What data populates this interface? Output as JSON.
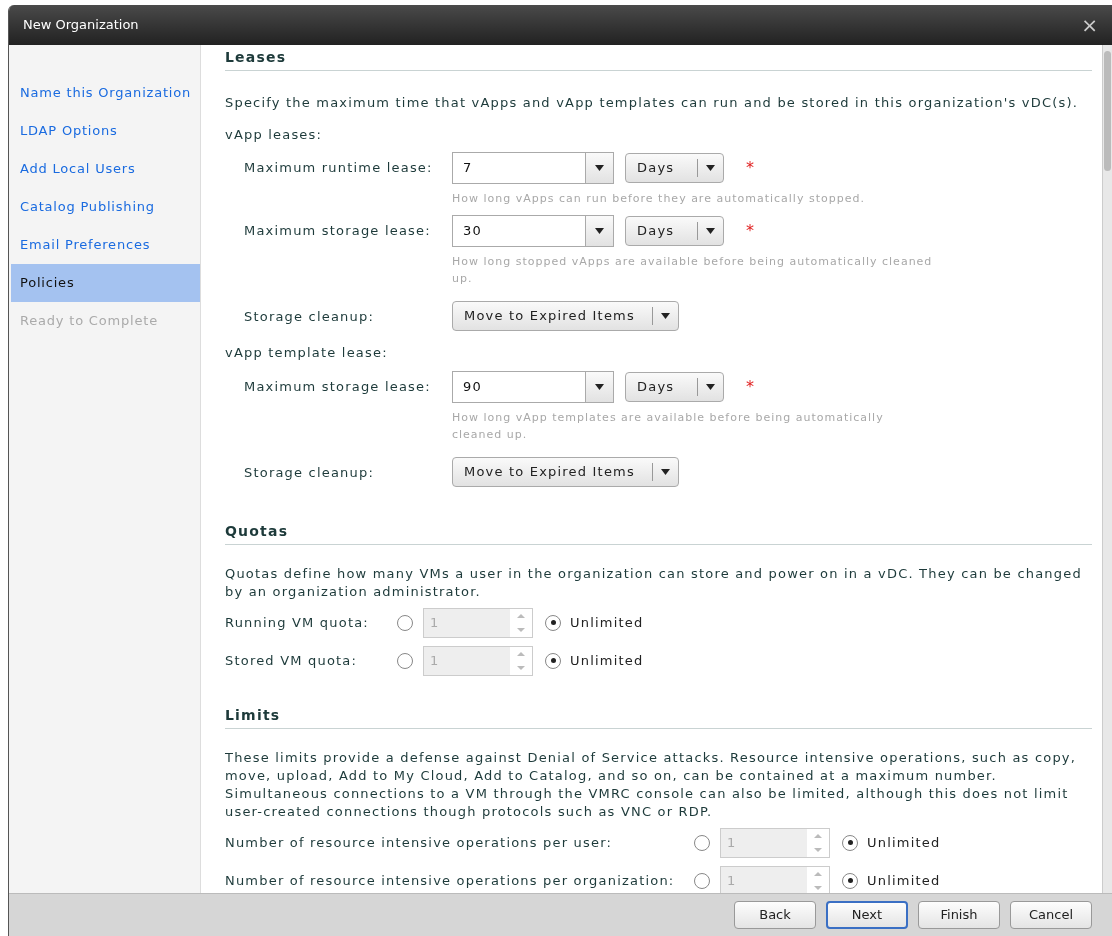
{
  "window": {
    "title": "New Organization",
    "close": "×"
  },
  "sidebar": {
    "items": [
      {
        "label": "Name this Organization",
        "selected": false,
        "disabled": false
      },
      {
        "label": "LDAP Options",
        "selected": false,
        "disabled": false
      },
      {
        "label": "Add Local Users",
        "selected": false,
        "disabled": false
      },
      {
        "label": "Catalog Publishing",
        "selected": false,
        "disabled": false
      },
      {
        "label": "Email Preferences",
        "selected": false,
        "disabled": false
      },
      {
        "label": "Policies",
        "selected": true,
        "disabled": false
      },
      {
        "label": "Ready to Complete",
        "selected": false,
        "disabled": true
      }
    ]
  },
  "leases": {
    "heading": "Leases",
    "description": "Specify the maximum time that vApps and vApp templates can run and be stored in this organization's vDC(s).",
    "groups": [
      {
        "label": "vApp leases:",
        "fields": [
          {
            "kind": "lease",
            "label": "Maximum runtime lease:",
            "value": "7",
            "unit": "Days",
            "required": true,
            "required_mark": "*",
            "hint": "How long vApps can run before they are automatically stopped."
          },
          {
            "kind": "lease",
            "label": "Maximum storage lease:",
            "value": "30",
            "unit": "Days",
            "required": true,
            "required_mark": "*",
            "hint": "How long stopped vApps are available before being automatically cleaned up."
          },
          {
            "kind": "select",
            "label": "Storage cleanup:",
            "value": "Move to Expired Items"
          }
        ]
      },
      {
        "label": "vApp template lease:",
        "fields": [
          {
            "kind": "lease",
            "label": "Maximum storage lease:",
            "value": "90",
            "unit": "Days",
            "required": true,
            "required_mark": "*",
            "hint": "How long vApp templates are available before being automatically cleaned up."
          },
          {
            "kind": "select",
            "label": "Storage cleanup:",
            "value": "Move to Expired Items"
          }
        ]
      }
    ]
  },
  "quotas": {
    "heading": "Quotas",
    "description": "Quotas define how many VMs a user in the organization can store and power on in a vDC. They can be changed by an organization administrator.",
    "rows": [
      {
        "label": "Running VM quota:",
        "limit_selected": false,
        "value": "1",
        "unlimited_label": "Unlimited",
        "unlimited_selected": true
      },
      {
        "label": "Stored VM quota:",
        "limit_selected": false,
        "value": "1",
        "unlimited_label": "Unlimited",
        "unlimited_selected": true
      }
    ]
  },
  "limits": {
    "heading": "Limits",
    "description": "These limits provide a defense against Denial of Service attacks. Resource intensive operations, such as copy, move, upload, Add to My Cloud, Add to Catalog, and so on, can be contained at a maximum number. Simultaneous connections to a VM through the VMRC console can also be limited, although this does not limit user-created connections though protocols such as VNC or RDP.",
    "rows": [
      {
        "label": "Number of resource intensive operations per user:",
        "limit_selected": false,
        "value": "1",
        "unlimited_label": "Unlimited",
        "unlimited_selected": true
      },
      {
        "label": "Number of resource intensive operations per organization:",
        "limit_selected": false,
        "value": "1",
        "unlimited_label": "Unlimited",
        "unlimited_selected": true
      }
    ]
  },
  "buttons": [
    {
      "label": "Back",
      "focused": false
    },
    {
      "label": "Next",
      "focused": true
    },
    {
      "label": "Finish",
      "focused": false
    },
    {
      "label": "Cancel",
      "focused": false
    }
  ]
}
